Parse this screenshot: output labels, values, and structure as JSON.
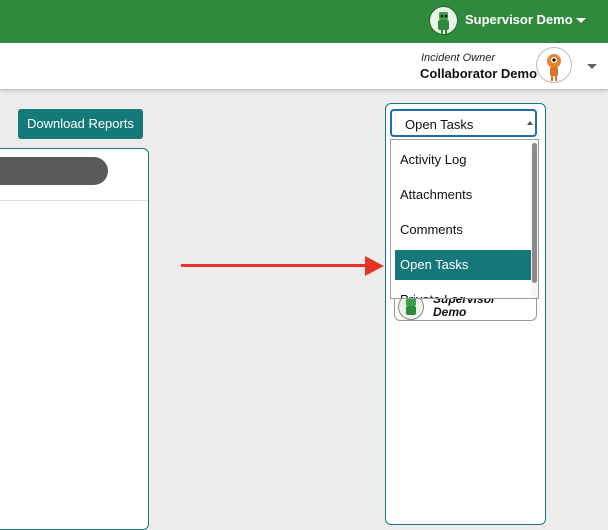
{
  "header": {
    "user_name": "Supervisor Demo",
    "brand_color": "#2f8a3e"
  },
  "subheader": {
    "owner_label": "Incident Owner",
    "owner_name": "Collaborator Demo"
  },
  "toolbar": {
    "download_label": "Download Reports",
    "accent_color": "#15797a"
  },
  "right_panel": {
    "select_value": "Open Tasks",
    "options": [
      {
        "label": "Activity Log"
      },
      {
        "label": "Attachments"
      },
      {
        "label": "Comments"
      },
      {
        "label": "Open Tasks",
        "selected": true
      },
      {
        "label": "Private Log"
      }
    ],
    "peek_name": "Supervisor Demo"
  },
  "annotation": {
    "arrow_color": "#e33428"
  }
}
